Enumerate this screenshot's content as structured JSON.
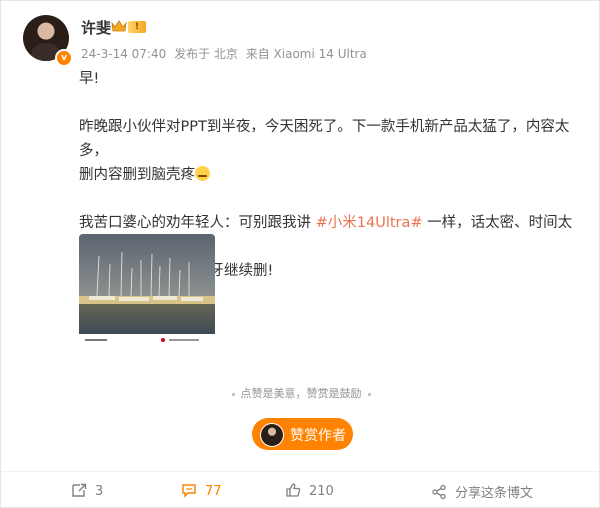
{
  "author": {
    "name": "许斐",
    "member_tag": "!",
    "avatar_badge": "v"
  },
  "meta": {
    "timestamp": "24-3-14 07:40",
    "location": "发布于 北京",
    "source": "来自 Xiaomi 14 Ultra"
  },
  "post": {
    "line1": "早!",
    "line2a": "昨晚跟小伙伴对PPT到半夜，今天困死了。下一款手机新产品太猛了，内容太多，",
    "line2b": "删内容删到脑壳疼",
    "line3a": "我苦口婆心的劝年轻人：可别跟我讲",
    "topic": "#小米14Ultra#",
    "line3b": "一样，话太密、时间太长、",
    "line3c": "听着太累，还是得咬牙继续删!"
  },
  "reward": {
    "tip_left": "点赞是美意",
    "tip_right": "赞赏是鼓励",
    "button_label": "赞赏作者"
  },
  "toolbar": {
    "forward_count": "3",
    "comment_count": "77",
    "like_count": "210",
    "share_label": "分享这条博文"
  },
  "colors": {
    "accent": "#ff8200",
    "topic": "#eb7350",
    "meta_text": "#939393"
  },
  "icons": [
    "crown-icon",
    "forward-icon",
    "comment-icon",
    "like-icon",
    "share-icon"
  ]
}
